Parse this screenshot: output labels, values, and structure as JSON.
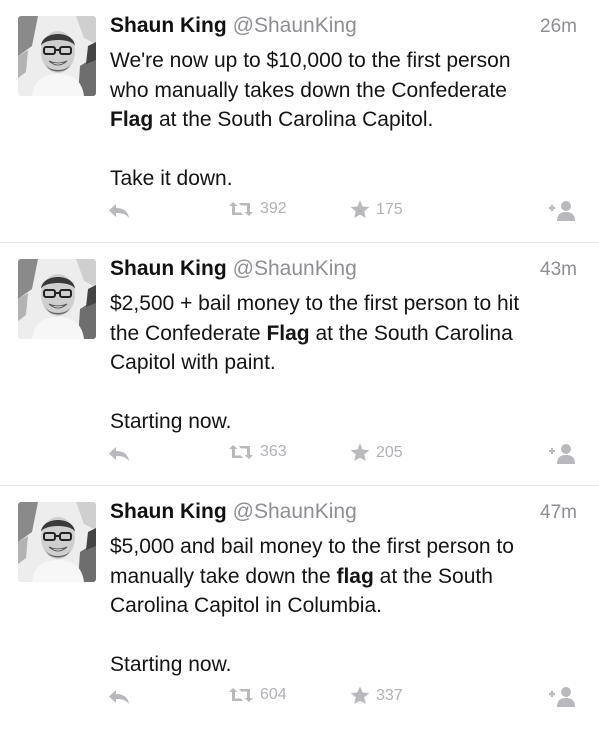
{
  "tweets": [
    {
      "name": "Shaun King",
      "handle": "@ShaunKing",
      "time": "26m",
      "line1": "We're now up to $10,000 to the first person",
      "line2": "who manually takes down the Confederate",
      "line3_bold": "Flag",
      "line3_rest": " at the South Carolina Capitol.",
      "closing": "Take it down.",
      "retweets": "392",
      "favorites": "175"
    },
    {
      "name": "Shaun King",
      "handle": "@ShaunKing",
      "time": "43m",
      "line1": "$2,500 + bail money to the first person to hit",
      "line2_pre": "the Confederate ",
      "line2_bold": "Flag",
      "line2_post": " at the South Carolina",
      "line3": "Capitol with paint.",
      "closing": "Starting now.",
      "retweets": "363",
      "favorites": "205"
    },
    {
      "name": "Shaun King",
      "handle": "@ShaunKing",
      "time": "47m",
      "line1": "$5,000 and bail money to the first person to",
      "line2_pre": "manually take down the ",
      "line2_bold": "flag",
      "line2_post": " at the South",
      "line3": "Carolina Capitol in Columbia.",
      "closing": "Starting now.",
      "retweets": "604",
      "favorites": "337"
    }
  ],
  "icons": {
    "reply": "reply-arrow-icon",
    "retweet": "retweet-icon",
    "favorite": "star-icon",
    "follow": "add-user-icon"
  },
  "colors": {
    "icon_gray": "#b9b9bd",
    "meta_gray": "#8e8e93",
    "text": "#141414"
  }
}
